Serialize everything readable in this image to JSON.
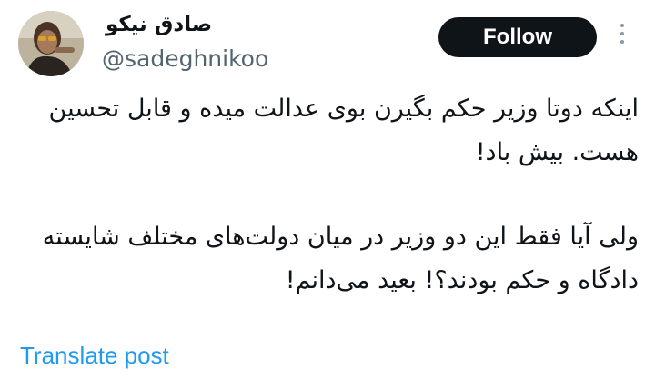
{
  "author": {
    "display_name": "صادق نیکو",
    "handle": "@sadeghnikoo"
  },
  "actions": {
    "follow_label": "Follow",
    "translate_label": "Translate post"
  },
  "tweet": {
    "paragraph_1": "اینکه دوتا وزیر حکم بگیرن بوی عدالت میده و قابل تحسین هست. بیش باد!",
    "paragraph_2": "ولی آیا فقط این دو وزیر در میان دولت‌های مختلف شایسته دادگاه و حکم بودند؟! بعید می‌دانم!"
  },
  "colors": {
    "follow_button_bg": "#0f1419",
    "link": "#1d9bf0",
    "secondary_text": "#536471"
  },
  "icons": {
    "more": "more-vertical-icon"
  }
}
